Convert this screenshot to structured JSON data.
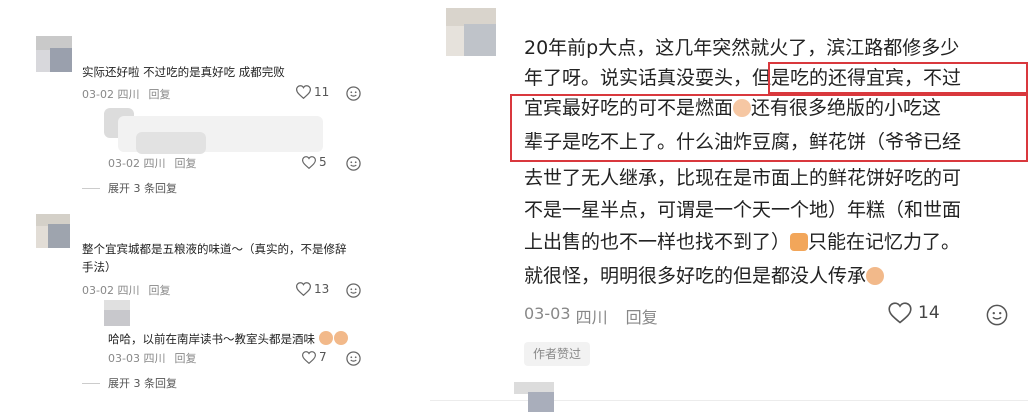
{
  "left": {
    "comments": [
      {
        "text": "实际还好啦 不过吃的是真好吃 成都完败",
        "date": "03-02",
        "location": "四川",
        "reply_label": "回复",
        "likes": "11"
      },
      {
        "date": "03-02",
        "location": "四川",
        "reply_label": "回复",
        "likes": "5",
        "expand_label": "展开 3 条回复"
      },
      {
        "text_line1": "整个宜宾城都是五粮液的味道～（真实的，不是修辞",
        "text_line2": "手法）",
        "date": "03-02",
        "location": "四川",
        "reply_label": "回复",
        "likes": "13"
      },
      {
        "text": "哈哈，以前在南岸读书～教室头都是酒味",
        "date": "03-03",
        "location": "四川",
        "reply_label": "回复",
        "likes": "7",
        "expand_label": "展开 3 条回复"
      }
    ]
  },
  "right": {
    "comment": {
      "lines": [
        "20年前p大点，这几年突然就火了，滨江路都修多少",
        "年了呀。说实话真没耍头，但是吃的还得宜宾，不过",
        "宜宾最好吃的可不是燃面",
        "还有很多绝版的小吃这",
        "辈子是吃不上了。什么油炸豆腐，鲜花饼（爷爷已经",
        "去世了无人继承，比现在是市面上的鲜花饼好吃的可",
        "不是一星半点，可谓是一个天一个地）年糕（和世面",
        "上出售的也不一样也找不到了）",
        "只能在记忆力了。",
        "就很怪，明明很多好吃的但是都没人传承"
      ],
      "date": "03-03",
      "location": "四川",
      "reply_label": "回复",
      "likes": "14",
      "badge": "作者赞过"
    },
    "highlight_color": "#d9383d"
  },
  "icons": {
    "like": "heart-outline-icon",
    "emoji": "smiley-face-icon"
  }
}
